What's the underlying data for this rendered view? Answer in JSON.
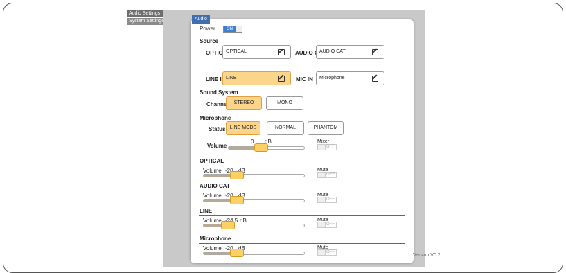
{
  "nav": {
    "items": [
      {
        "label": "Audio Settings"
      },
      {
        "label": "System Settings"
      }
    ]
  },
  "panel": {
    "tab_label": "Audio"
  },
  "power": {
    "label": "Power",
    "state": "ON"
  },
  "source": {
    "heading": "Source",
    "optical": {
      "label": "OPTICAL",
      "value": "OPTICAL"
    },
    "audio_cat": {
      "label": "AUDIO CAT",
      "value": "AUDIO CAT"
    },
    "line_in": {
      "label": "LINE IN",
      "value": "LINE"
    },
    "mic_in": {
      "label": "MIC IN",
      "value": "Microphone"
    }
  },
  "sound_system": {
    "heading": "Sound System",
    "channel_label": "Channel",
    "options": [
      {
        "label": "STEREO"
      },
      {
        "label": "MONO"
      }
    ],
    "selected": "STEREO"
  },
  "microphone": {
    "heading": "Microphone",
    "status_label": "Status",
    "status_options": [
      {
        "label": "LINE MODE"
      },
      {
        "label": "NORMAL"
      },
      {
        "label": "PHANTOM"
      }
    ],
    "selected": "LINE MODE",
    "volume_label": "Volume",
    "volume_value": "0",
    "volume_unit": "dB",
    "volume_level": 0.43,
    "mixer_label": "Mixer",
    "mixer_state": "OFF"
  },
  "channels": [
    {
      "heading": "OPTICAL",
      "volume_label": "Volume",
      "value": "-20",
      "unit": "dB",
      "level": 0.33,
      "mute_label": "Mute",
      "mute_state": "OFF"
    },
    {
      "heading": "AUDIO CAT",
      "volume_label": "Volume",
      "value": "-20",
      "unit": "dB",
      "level": 0.33,
      "mute_label": "Mute",
      "mute_state": "OFF"
    },
    {
      "heading": "LINE",
      "volume_label": "Volume",
      "value": "-24.5",
      "unit": "dB",
      "level": 0.24,
      "mute_label": "Mute",
      "mute_state": "OFF"
    },
    {
      "heading": "Microphone",
      "volume_label": "Volume",
      "value": "-20",
      "unit": "dB",
      "level": 0.33,
      "mute_label": "Mute",
      "mute_state": "OFF"
    }
  ],
  "version": "Version:V0.2",
  "colors": {
    "accent": "#fdd58a",
    "tab": "#3f6fb0",
    "toggle_on": "#3f7fd0"
  }
}
